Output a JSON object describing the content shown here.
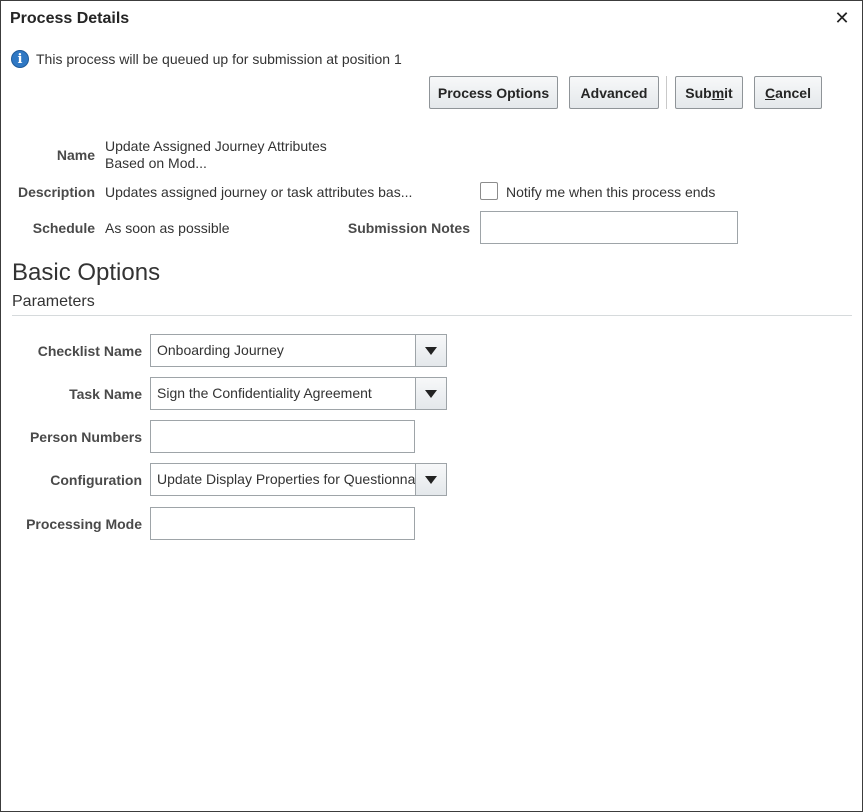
{
  "dialog": {
    "title": "Process Details",
    "close_icon": "close-icon"
  },
  "info": {
    "icon": "info-icon",
    "message": "This process will be queued up for submission at position 1"
  },
  "toolbar": {
    "process_options_label": "Process Options",
    "advanced_label": "Advanced",
    "submit_pre": "Sub",
    "submit_u": "m",
    "submit_post": "it",
    "cancel_u": "C",
    "cancel_post": "ancel"
  },
  "details": {
    "name_label": "Name",
    "name_line1": "Update Assigned Journey Attributes",
    "name_line2": "Based on Mod...",
    "description_label": "Description",
    "description_value": "Updates assigned journey or task attributes bas...",
    "notify_label": "Notify me when this process ends",
    "notify_checked": false,
    "schedule_label": "Schedule",
    "schedule_value": "As soon as possible",
    "submission_notes_label": "Submission Notes",
    "submission_notes_value": ""
  },
  "basic_options": {
    "heading": "Basic Options",
    "subheading": "Parameters"
  },
  "parameters": {
    "checklist_name_label": "Checklist Name",
    "checklist_name_value": "Onboarding Journey",
    "task_name_label": "Task Name",
    "task_name_value": "Sign the Confidentiality Agreement",
    "person_numbers_label": "Person Numbers",
    "person_numbers_value": "",
    "configuration_label": "Configuration",
    "configuration_value": "Update Display Properties for Questionnaire",
    "processing_mode_label": "Processing Mode",
    "processing_mode_value": ""
  }
}
